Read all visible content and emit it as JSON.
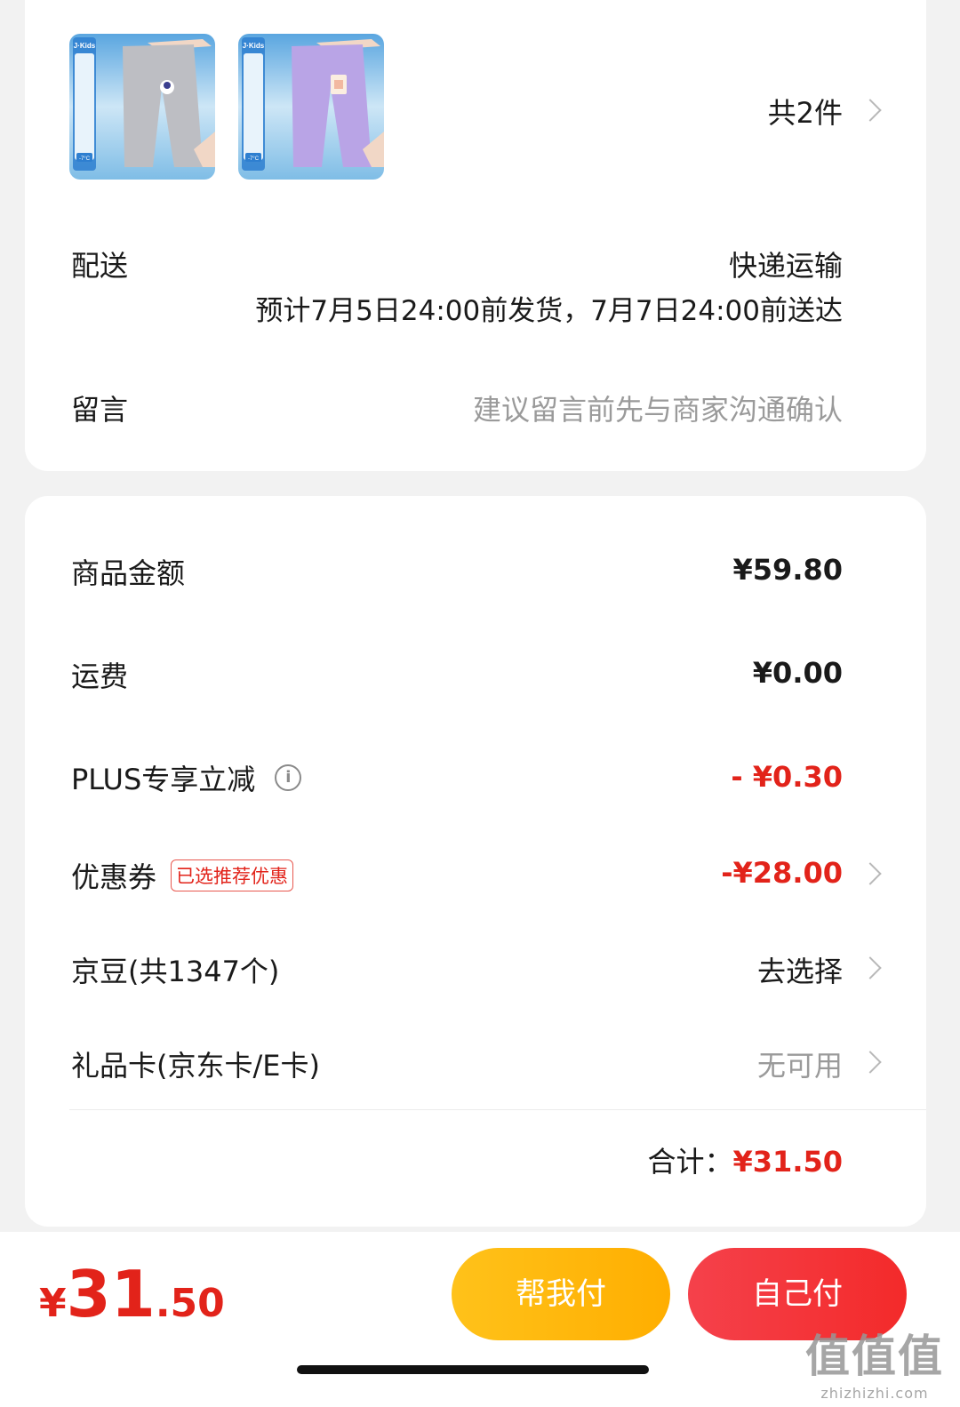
{
  "order": {
    "items_count": "共2件",
    "products": [
      {
        "name": "grey-pants-image",
        "color": "#bdbec3"
      },
      {
        "name": "purple-pants-image",
        "color": "#b9a4e6"
      }
    ],
    "brand_badge": "J·Kids",
    "temp_badge": "-7°C",
    "delivery_label": "配送",
    "delivery_method": "快递运输",
    "delivery_eta": "预计7月5日24:00前发货，7月7日24:00前送达",
    "message_label": "留言",
    "message_placeholder": "建议留言前先与商家沟通确认"
  },
  "price": {
    "goods_label": "商品金额",
    "goods_value": "¥59.80",
    "shipping_label": "运费",
    "shipping_value": "¥0.00",
    "plus_label": "PLUS专享立减",
    "plus_value": "- ¥0.30",
    "coupon_label": "优惠券",
    "coupon_tag": "已选推荐优惠",
    "coupon_value": "-¥28.00",
    "beans_label": "京豆(共1347个)",
    "beans_value": "去选择",
    "giftcard_label": "礼品卡(京东卡/E卡)",
    "giftcard_value": "无可用",
    "total_label": "合计：",
    "total_value": "¥31.50"
  },
  "footer": {
    "currency": "¥",
    "amount_int": "31",
    "amount_dec": ".50",
    "help_pay": "帮我付",
    "self_pay": "自己付",
    "watermark_logo": "值值值",
    "watermark_url": "zhizhizhi.com"
  },
  "colors": {
    "accent_red": "#e2231a",
    "help_btn": "#ffb800",
    "self_btn": "#f33a3a"
  }
}
